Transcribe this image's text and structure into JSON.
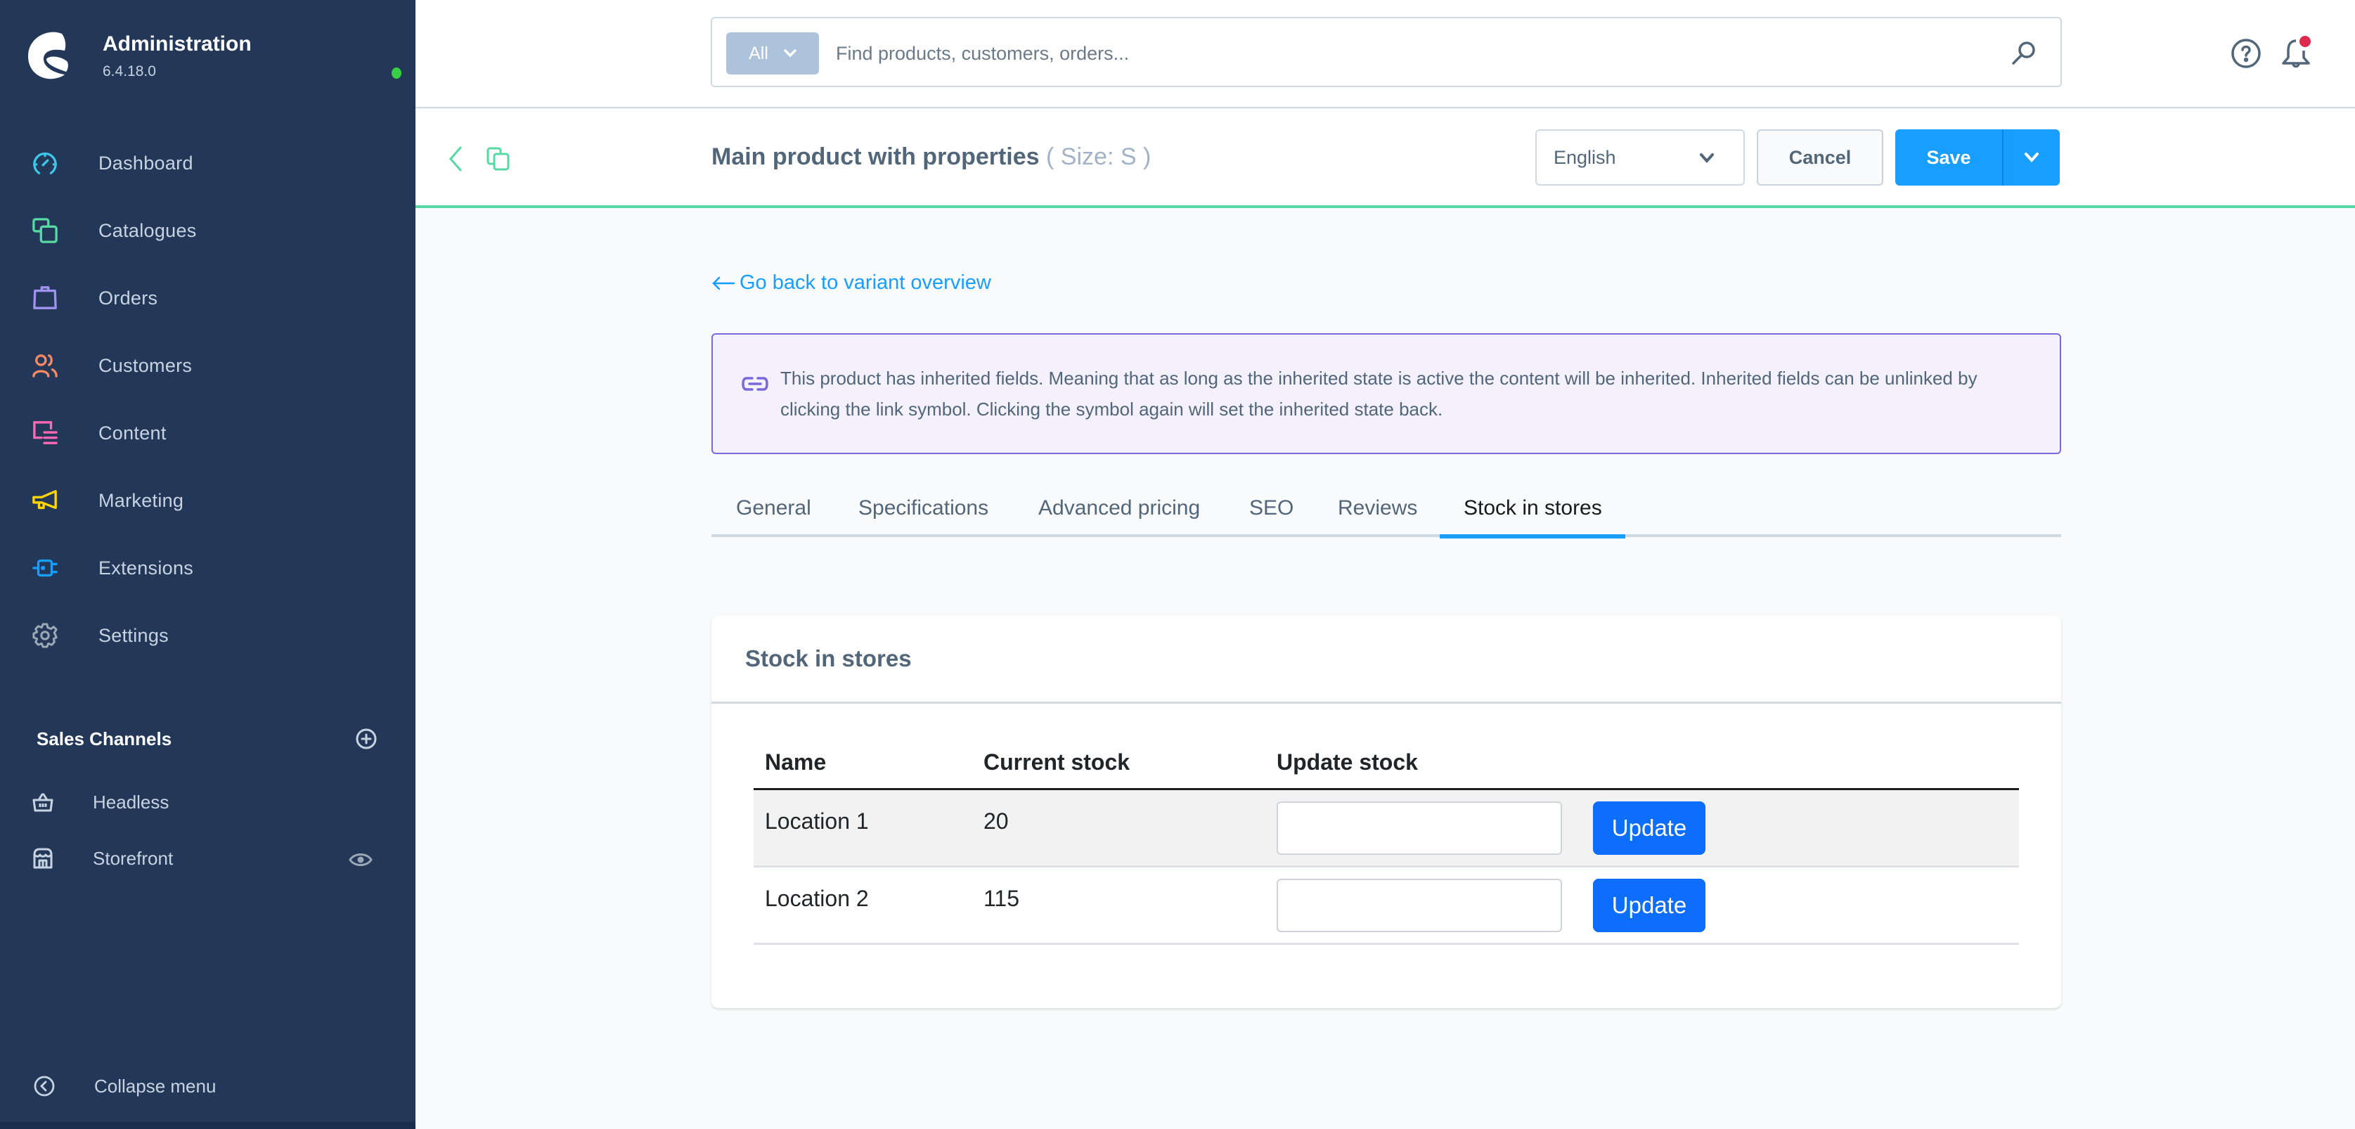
{
  "app": {
    "title": "Administration",
    "version": "6.4.18.0",
    "status_color": "#37d046"
  },
  "sidebar": {
    "items": [
      {
        "id": "dashboard",
        "label": "Dashboard",
        "icon": "dashboard-gauge-icon",
        "color": "#3ec6e8"
      },
      {
        "id": "catalogues",
        "label": "Catalogues",
        "icon": "catalogues-icon",
        "color": "#57d9a3"
      },
      {
        "id": "orders",
        "label": "Orders",
        "icon": "orders-bag-icon",
        "color": "#a092f0"
      },
      {
        "id": "customers",
        "label": "Customers",
        "icon": "customers-icon",
        "color": "#f88962"
      },
      {
        "id": "content",
        "label": "Content",
        "icon": "content-icon",
        "color": "#ff68b4"
      },
      {
        "id": "marketing",
        "label": "Marketing",
        "icon": "marketing-megaphone-icon",
        "color": "#ffd700"
      },
      {
        "id": "extensions",
        "label": "Extensions",
        "icon": "extensions-plug-icon",
        "color": "#189eff"
      },
      {
        "id": "settings",
        "label": "Settings",
        "icon": "settings-gear-icon",
        "color": "#9aa8b5"
      }
    ],
    "sales_channels": {
      "title": "Sales Channels",
      "items": [
        {
          "label": "Headless",
          "icon": "basket-icon"
        },
        {
          "label": "Storefront",
          "icon": "storefront-icon",
          "has_preview": true
        }
      ]
    },
    "collapse_label": "Collapse menu"
  },
  "topbar": {
    "search": {
      "type_label": "All",
      "placeholder": "Find products, customers, orders...",
      "value": ""
    },
    "notification_badge_color": "#de294c"
  },
  "smartbar": {
    "title": "Main product with properties",
    "subtitle": "( Size: S )",
    "language": "English",
    "cancel_label": "Cancel",
    "save_label": "Save",
    "accent_color": "#189eff"
  },
  "content": {
    "back_link": "Go back to variant overview",
    "inherit_notice": "This product has inherited fields. Meaning that as long as the inherited state is active the content will be inherited. Inherited fields can be unlinked by clicking the link symbol. Clicking the symbol again will set the inherited state back.",
    "tabs": [
      {
        "label": "General",
        "active": false
      },
      {
        "label": "Specifications",
        "active": false
      },
      {
        "label": "Advanced pricing",
        "active": false
      },
      {
        "label": "SEO",
        "active": false
      },
      {
        "label": "Reviews",
        "active": false
      },
      {
        "label": "Stock in stores",
        "active": true
      }
    ],
    "stock_card": {
      "title": "Stock in stores",
      "columns": [
        "Name",
        "Current stock",
        "Update stock"
      ],
      "rows": [
        {
          "name": "Location 1",
          "current_stock": "20",
          "update_value": "",
          "button_label": "Update"
        },
        {
          "name": "Location 2",
          "current_stock": "115",
          "update_value": "",
          "button_label": "Update"
        }
      ]
    }
  }
}
